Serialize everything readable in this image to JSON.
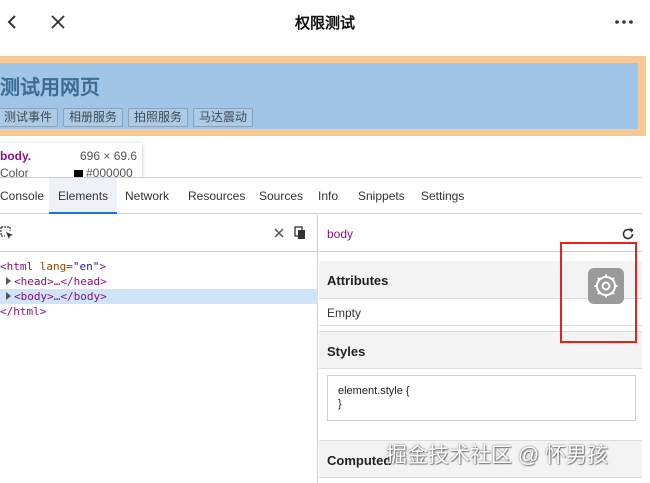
{
  "topbar": {
    "title": "权限测试",
    "back_icon": "chevron-left-icon",
    "close_icon": "close-icon",
    "more_icon": "more-horizontal-icon"
  },
  "preview": {
    "heading": "测试用网页",
    "buttons": [
      "测试事件",
      "相册服务",
      "拍照服务",
      "马达震动"
    ],
    "colors": {
      "outer": "#f7c995",
      "inner": "#a0c5e6"
    }
  },
  "tooltip": {
    "tag": "body.",
    "dims": "696 × 69.6",
    "color_label": "Color",
    "color_value": "#000000"
  },
  "devtools": {
    "tabs": [
      "Console",
      "Elements",
      "Network",
      "Resources",
      "Sources",
      "Info",
      "Snippets",
      "Settings"
    ],
    "active_tab": "Elements",
    "dom": {
      "html_open": "<html ",
      "html_attr_name": "lang",
      "html_attr_eq": "=",
      "html_attr_value": "\"en\"",
      "html_close_bracket": ">",
      "head": "<head>…</head>",
      "body": "<body>…</body>",
      "html_close": "</html>"
    },
    "breadcrumb": "body",
    "attributes": {
      "title": "Attributes",
      "value": "Empty"
    },
    "styles": {
      "title": "Styles",
      "line1": "element.style {",
      "line2": "}"
    },
    "computed": {
      "title": "Computed"
    }
  },
  "watermark": "掘金技术社区 @ 怀男孩",
  "colors": {
    "highlight": "#e5231b",
    "selection": "#cfe3f9",
    "accent": "#1a73e8"
  }
}
